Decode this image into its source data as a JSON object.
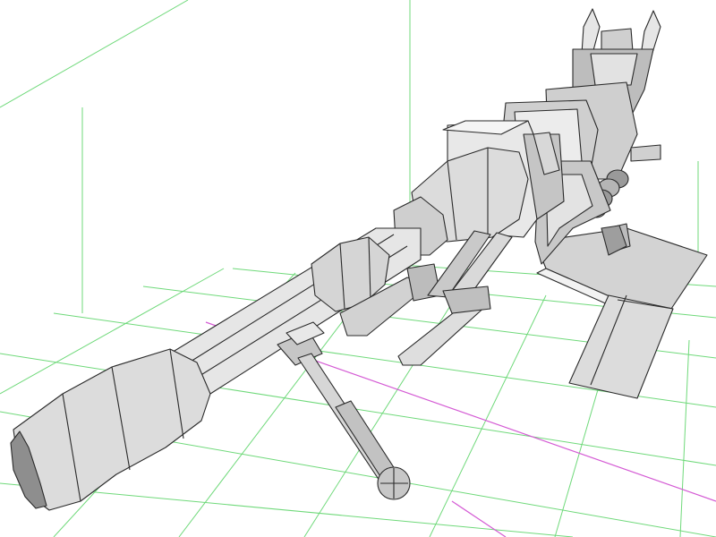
{
  "viewport": {
    "view_name": "",
    "background_color": "#ffffff",
    "grid_color": "#6fd97a",
    "axis_color": "#d45ad4",
    "face_light": "#f2f2f2",
    "face_mid": "#d3d3d3",
    "face_dark": "#a6a6a6",
    "edge_color": "#2a2a2a"
  },
  "model": {
    "subject": "rifle-wireframe-model"
  }
}
